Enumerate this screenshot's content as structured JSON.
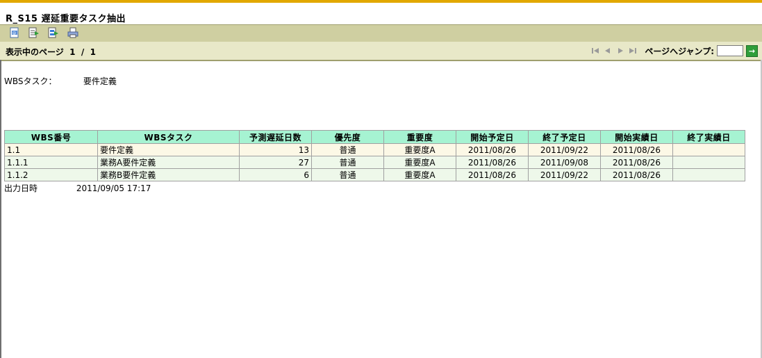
{
  "report": {
    "title": "R_S15 遅延重要タスク抽出"
  },
  "toolbar": {
    "icons": [
      "csv-export-icon",
      "excel-export-icon",
      "pdf-export-icon",
      "print-icon"
    ]
  },
  "pager": {
    "label": "表示中のページ",
    "current": "1",
    "separator": "/",
    "total": "1",
    "jump_label": "ページへジャンプ:",
    "jump_value": "",
    "go_symbol": "→"
  },
  "criteria": {
    "label": "WBSタスク：",
    "value": "要件定義"
  },
  "table": {
    "headers": [
      "WBS番号",
      "WBSタスク",
      "予測遅延日数",
      "優先度",
      "重要度",
      "開始予定日",
      "終了予定日",
      "開始実績日",
      "終了実績日"
    ],
    "rows": [
      [
        "1.1",
        "要件定義",
        "13",
        "普通",
        "重要度A",
        "2011/08/26",
        "2011/09/22",
        "2011/08/26",
        ""
      ],
      [
        "1.1.1",
        "業務A要件定義",
        "27",
        "普通",
        "重要度A",
        "2011/08/26",
        "2011/09/08",
        "2011/08/26",
        ""
      ],
      [
        "1.1.2",
        "業務B要件定義",
        "6",
        "普通",
        "重要度A",
        "2011/08/26",
        "2011/09/22",
        "2011/08/26",
        ""
      ]
    ]
  },
  "footer": {
    "label": "出力日時",
    "value": "2011/09/05 17:17"
  },
  "colors": {
    "header_bg": "#a6f3d2",
    "toolbar_bg": "#cfcfa1",
    "accent": "#e2a800"
  }
}
